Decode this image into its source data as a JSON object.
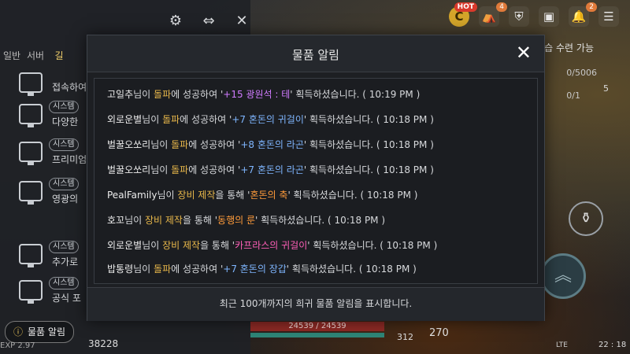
{
  "modal": {
    "title": "물품 알림",
    "close": "✕",
    "notifications": [
      {
        "player": "고일추",
        "p1": "님이 ",
        "method": "돌파",
        "p2": "에 성공하여 '",
        "item": "+15 광원석 : 테",
        "color": "purple",
        "p3": "' 획득하셨습니다. ( 10:19 PM )"
      },
      {
        "player": "외로운별",
        "p1": "님이 ",
        "method": "돌파",
        "p2": "에 성공하여 '",
        "item": "+7 혼돈의 귀걸이",
        "color": "blue",
        "p3": "' 획득하셨습니다. ( 10:18 PM )"
      },
      {
        "player": "벌꿀오쏘리",
        "p1": "님이 ",
        "method": "돌파",
        "p2": "에 성공하여 '",
        "item": "+8 혼돈의 라곤",
        "color": "blue",
        "p3": "' 획득하셨습니다. ( 10:18 PM )"
      },
      {
        "player": "벌꿀오쏘리",
        "p1": "님이 ",
        "method": "돌파",
        "p2": "에 성공하여 '",
        "item": "+7 혼돈의 라곤",
        "color": "blue",
        "p3": "' 획득하셨습니다. ( 10:18 PM )"
      },
      {
        "player": "PealFamily",
        "p1": "님이 ",
        "method": "장비 제작",
        "p2": "을 통해 '",
        "item": "혼돈의 축",
        "color": "orange",
        "p3": "' 획득하셨습니다. ( 10:18 PM )"
      },
      {
        "player": "호꼬",
        "p1": "님이 ",
        "method": "장비 제작",
        "p2": "을 통해 '",
        "item": "동행의 룬",
        "color": "orange",
        "p3": "' 획득하셨습니다. ( 10:18 PM )"
      },
      {
        "player": "외로운별",
        "p1": "님이 ",
        "method": "장비 제작",
        "p2": "을 통해 '",
        "item": "카프라스의 귀걸이",
        "color": "pink",
        "p3": "' 획득하셨습니다. ( 10:18 PM )"
      },
      {
        "player": "밥통령",
        "p1": "님이 ",
        "method": "돌파",
        "p2": "에 성공하여 '",
        "item": "+7 혼돈의 장갑",
        "color": "blue",
        "p3": "' 획득하셨습니다. ( 10:18 PM )"
      }
    ],
    "footer": "최근 100개까지의 희귀 물품 알림을 표시합니다."
  },
  "chat": {
    "tabs": [
      "일반",
      "서버",
      "길"
    ],
    "rows": [
      {
        "badge": "",
        "text": "접속하여"
      },
      {
        "badge": "시스템",
        "text": "다양한"
      },
      {
        "badge": "시스템",
        "text": "프리미엄"
      },
      {
        "badge": "시스템",
        "text": "영광의"
      },
      {
        "badge": "시스템",
        "text": "추가로"
      },
      {
        "badge": "시스템",
        "text": "공식 포"
      }
    ]
  },
  "hud": {
    "coin_label": "C",
    "hot_badge": "HOT",
    "tent_badge": "4",
    "bell_badge": "2",
    "learn_label": "습 수련 가능",
    "resource_1": "0/5006",
    "resource_2": "0/1",
    "side_count": "5",
    "notify_button": "물품 알림",
    "hp_text": "24539 / 24539",
    "num_312": "312",
    "num_270": "270",
    "gold": "38228",
    "exp": "EXP 2.97",
    "network": "LTE",
    "clock": "22 : 18"
  },
  "colors": {
    "blue": "#7fb6ff",
    "purple": "#d07bff",
    "orange": "#ff9b3a",
    "pink": "#ff5fb8",
    "method": "#e9b84a"
  }
}
